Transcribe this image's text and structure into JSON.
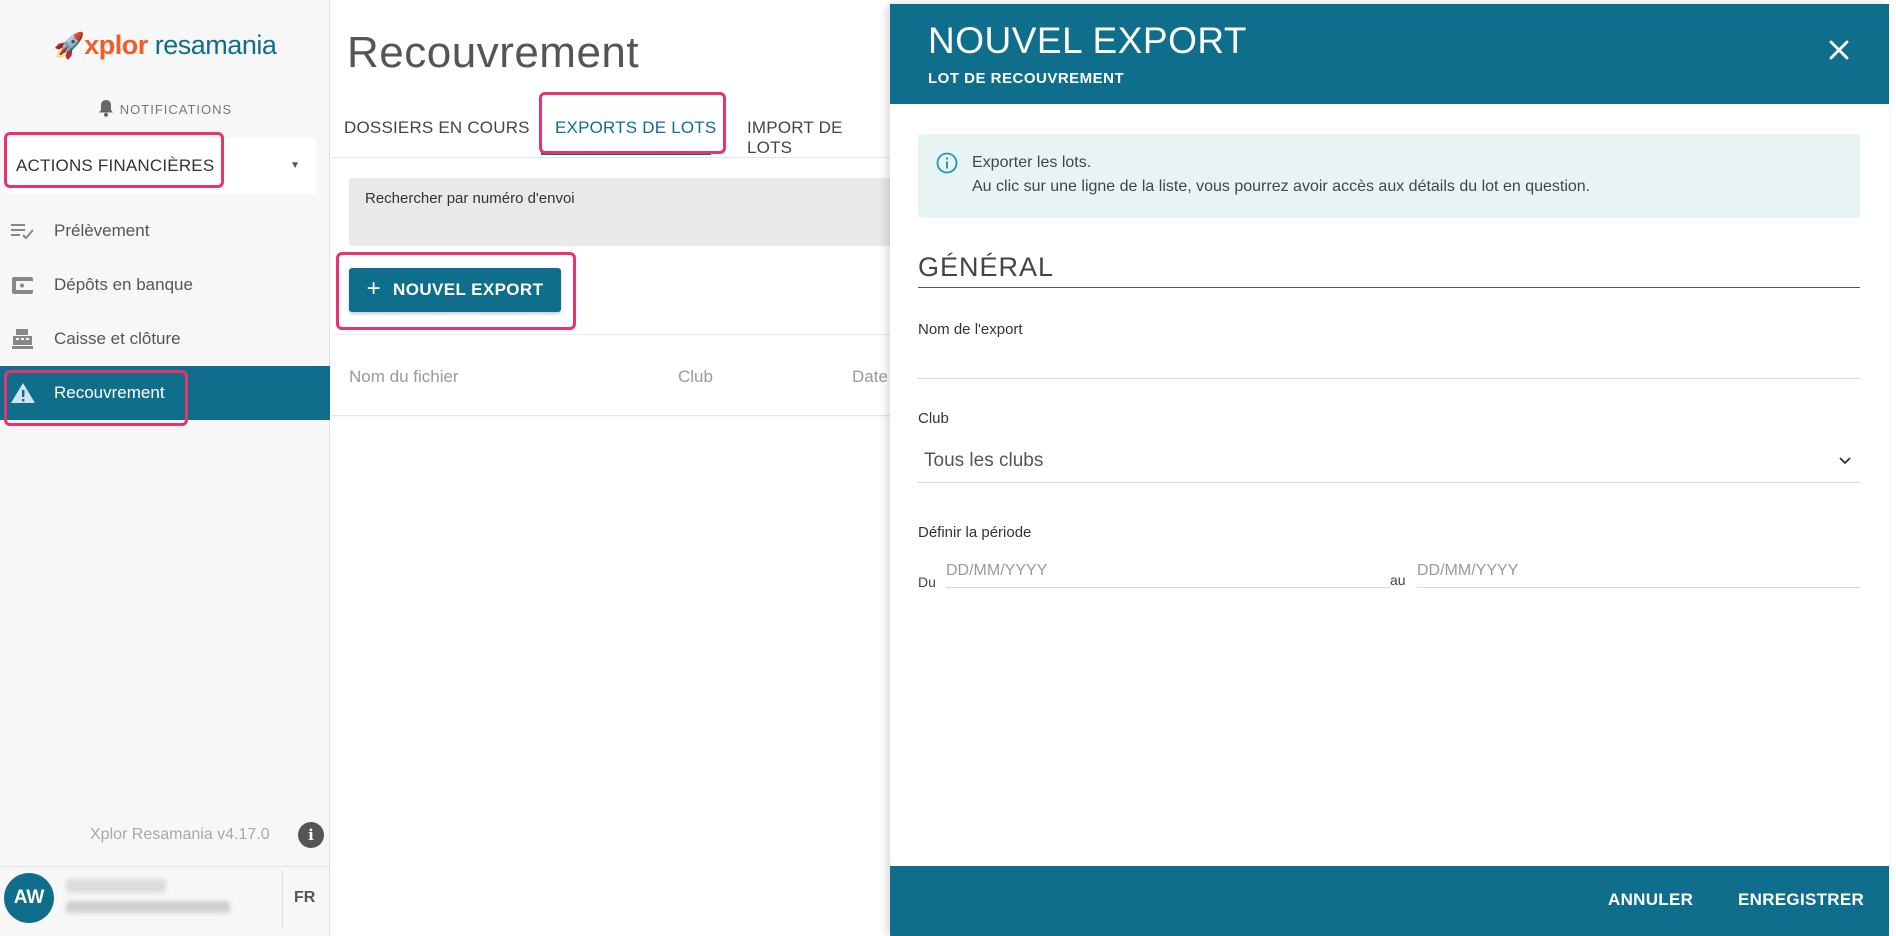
{
  "brand": {
    "logo_rocket": "🚀",
    "logo_part1": "xplor",
    "logo_part2": " resamania",
    "accent": "#0f6e8c",
    "logo_color": "#f25c2b",
    "highlight_color": "#e8336d"
  },
  "sidebar": {
    "notifications_label": "NOTIFICATIONS",
    "section_label": "ACTIONS FINANCIÈRES",
    "items": [
      {
        "label": "Prélèvement",
        "icon": "checklist-icon",
        "active": false
      },
      {
        "label": "Dépôts en banque",
        "icon": "wallet-icon",
        "active": false
      },
      {
        "label": "Caisse et clôture",
        "icon": "cash-register-icon",
        "active": false
      },
      {
        "label": "Recouvrement",
        "icon": "warning-icon",
        "active": true
      }
    ],
    "version": "Xplor Resamania v4.17.0",
    "user_initials": "AW",
    "language": "FR"
  },
  "main": {
    "title": "Recouvrement",
    "tabs": [
      {
        "label": "DOSSIERS EN COURS",
        "active": false
      },
      {
        "label": "EXPORTS DE LOTS",
        "active": true
      },
      {
        "label": "IMPORT DE LOTS",
        "active": false
      }
    ],
    "search_label": "Rechercher par numéro d'envoi",
    "new_export_button": "NOUVEL EXPORT",
    "columns": [
      "Nom du fichier",
      "Club",
      "Date"
    ]
  },
  "drawer": {
    "title": "NOUVEL EXPORT",
    "subtitle": "LOT DE RECOUVREMENT",
    "info_line1": "Exporter les lots.",
    "info_line2": "Au clic sur une ligne de la liste, vous pourrez avoir accès aux détails du lot en question.",
    "section_general": "GÉNÉRAL",
    "export_name_label": "Nom de l'export",
    "club_label": "Club",
    "club_value": "Tous les clubs",
    "period_label": "Définir la période",
    "from_label": "Du",
    "from_placeholder": "DD/MM/YYYY",
    "to_label": "au",
    "to_placeholder": "DD/MM/YYYY",
    "cancel_button": "ANNULER",
    "save_button": "ENREGISTRER"
  }
}
